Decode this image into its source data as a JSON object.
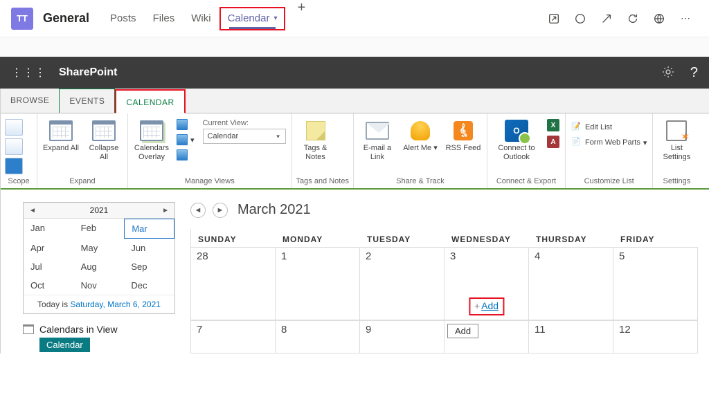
{
  "teams_header": {
    "avatar_initials": "TT",
    "channel_name": "General",
    "tabs": [
      "Posts",
      "Files",
      "Wiki"
    ],
    "active_tab": "Calendar"
  },
  "sharepoint": {
    "title": "SharePoint"
  },
  "ribbon_tabs": {
    "browse": "BROWSE",
    "events": "EVENTS",
    "calendar": "CALENDAR"
  },
  "ribbon": {
    "scope_label": "Scope",
    "expand": {
      "expand_all": "Expand All",
      "collapse_all": "Collapse All",
      "group": "Expand"
    },
    "manage": {
      "calendars_overlay": "Calendars Overlay",
      "current_view_label": "Current View:",
      "current_view_value": "Calendar",
      "group": "Manage Views"
    },
    "tags": {
      "tags_notes": "Tags & Notes",
      "group": "Tags and Notes"
    },
    "share": {
      "email_link": "E-mail a Link",
      "alert_me": "Alert Me",
      "rss_feed": "RSS Feed",
      "group": "Share & Track"
    },
    "connect": {
      "outlook": "Connect to Outlook",
      "group": "Connect & Export"
    },
    "customize": {
      "edit_list": "Edit List",
      "form_web_parts": "Form Web Parts",
      "group": "Customize List"
    },
    "settings": {
      "list_settings": "List Settings",
      "group": "Settings"
    }
  },
  "mini_cal": {
    "year": "2021",
    "months": [
      "Jan",
      "Feb",
      "Mar",
      "Apr",
      "May",
      "Jun",
      "Jul",
      "Aug",
      "Sep",
      "Oct",
      "Nov",
      "Dec"
    ],
    "selected_index": 2,
    "today_prefix": "Today is ",
    "today_link": "Saturday, March 6, 2021"
  },
  "calendars_in_view": {
    "label": "Calendars in View",
    "items": [
      "Calendar"
    ]
  },
  "big_cal": {
    "title": "March 2021",
    "day_headers": [
      "SUNDAY",
      "MONDAY",
      "TUESDAY",
      "WEDNESDAY",
      "THURSDAY",
      "FRIDAY"
    ],
    "row1": [
      "28",
      "1",
      "2",
      "3",
      "4",
      "5"
    ],
    "row2": [
      "7",
      "8",
      "9",
      "",
      "11",
      "12"
    ],
    "add_label": "Add",
    "add_plain": "Add"
  }
}
